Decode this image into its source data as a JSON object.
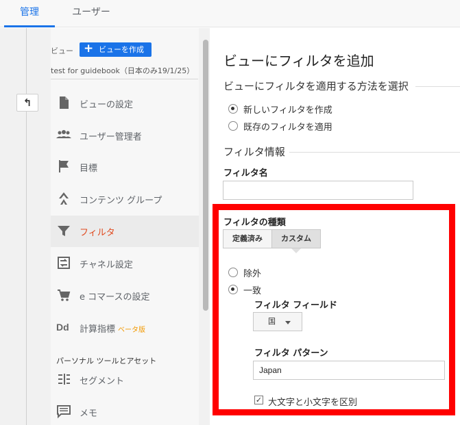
{
  "tabs": [
    {
      "label": "管理",
      "active": true
    },
    {
      "label": "ユーザー",
      "active": false
    }
  ],
  "sidebar": {
    "view_label": "ビュー",
    "create_view_label": "ビューを作成",
    "view_name": "test for guidebook（日本のみ19/1/25）",
    "items": [
      {
        "label": "ビューの設定",
        "icon": "document-icon"
      },
      {
        "label": "ユーザー管理者",
        "icon": "people-icon"
      },
      {
        "label": "目標",
        "icon": "flag-icon"
      },
      {
        "label": "コンテンツ グループ",
        "icon": "content-group-icon"
      },
      {
        "label": "フィルタ",
        "icon": "filter-icon",
        "active": true
      },
      {
        "label": "チャネル設定",
        "icon": "channel-icon"
      },
      {
        "label": "e コマースの設定",
        "icon": "cart-icon"
      },
      {
        "label": "計算指標",
        "icon": "dd-icon",
        "badge": "ベータ版"
      },
      {
        "label": "セグメント",
        "icon": "segment-icon"
      },
      {
        "label": "メモ",
        "icon": "memo-icon"
      }
    ],
    "section_personal": "パーソナル ツールとアセット"
  },
  "main": {
    "title": "ビューにフィルタを追加",
    "method_heading": "ビューにフィルタを適用する方法を選択",
    "method_options": [
      "新しいフィルタを作成",
      "既存のフィルタを適用"
    ],
    "info_heading": "フィルタ情報",
    "filter_name_label": "フィルタ名",
    "filter_name_value": "",
    "filter_type_label": "フィルタの種類",
    "type_tabs": [
      "定義済み",
      "カスタム"
    ],
    "exclude_label": "除外",
    "match_label": "一致",
    "field_label": "フィルタ フィールド",
    "field_value": "国",
    "pattern_label": "フィルタ パターン",
    "pattern_value": "Japan",
    "case_sensitive_label": "大文字と小文字を区別"
  },
  "colors": {
    "accent": "#1a73e8",
    "active_nav": "#e04a1f",
    "highlight": "#ff0000",
    "beta": "#f29900"
  }
}
